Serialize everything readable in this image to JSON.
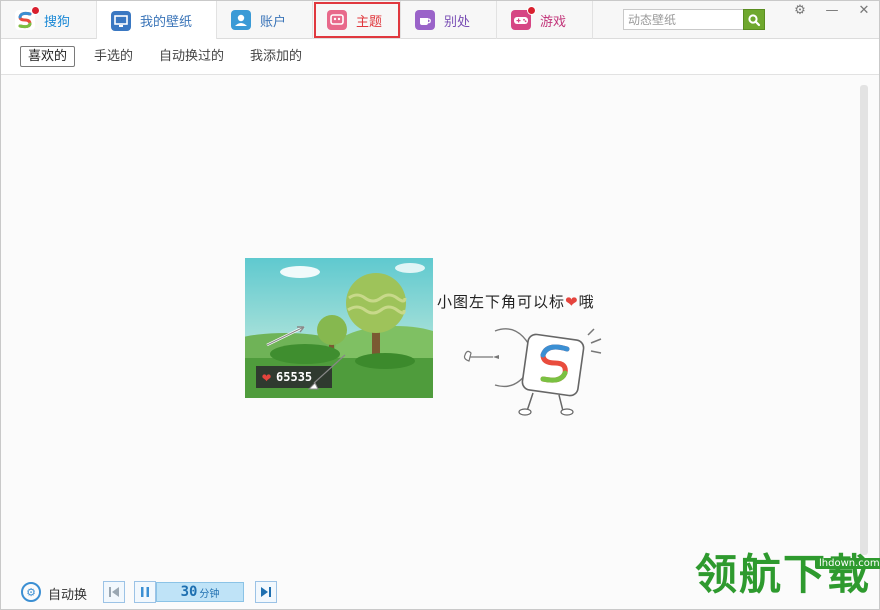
{
  "tabs": [
    {
      "label": "搜狗",
      "color": "#1d8ad6",
      "has_dot": true
    },
    {
      "label": "我的壁纸",
      "color": "#3a74b8",
      "has_dot": false
    },
    {
      "label": "账户",
      "color": "#3a74b8",
      "has_dot": false
    },
    {
      "label": "主题",
      "color": "#e0383e",
      "has_dot": false
    },
    {
      "label": "别处",
      "color": "#7a4fb5",
      "has_dot": false
    },
    {
      "label": "游戏",
      "color": "#c2357a",
      "has_dot": true
    }
  ],
  "search": {
    "placeholder": "动态壁纸"
  },
  "subtabs": [
    {
      "label": "喜欢的",
      "active": true
    },
    {
      "label": "手选的",
      "active": false
    },
    {
      "label": "自动换过的",
      "active": false
    },
    {
      "label": "我添加的",
      "active": false
    }
  ],
  "empty_state": {
    "likes_count": "65535",
    "hint_text": "小图左下角可以标",
    "hint_suffix": "哦"
  },
  "bottom": {
    "auto_label": "自动换",
    "interval_value": "30",
    "interval_unit": "分钟"
  },
  "watermark": {
    "text": "领航下载",
    "url": "lhdown.com"
  },
  "colors": {
    "accent": "#3b8fd3",
    "highlight": "#e0383e",
    "heart": "#e5443d"
  }
}
